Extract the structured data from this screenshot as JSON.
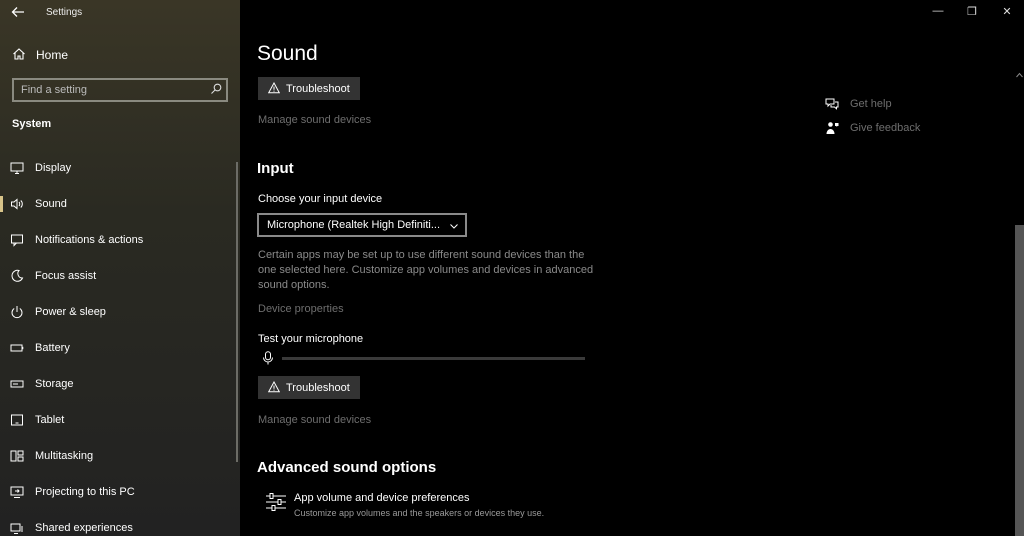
{
  "window": {
    "title": "Settings",
    "controls": {
      "minimize": "—",
      "restore": "❐",
      "close": "✕"
    }
  },
  "sidebar": {
    "home_label": "Home",
    "search_placeholder": "Find a setting",
    "section_label": "System",
    "items": [
      {
        "label": "Display",
        "icon": "display-icon"
      },
      {
        "label": "Sound",
        "icon": "speaker-icon",
        "active": true
      },
      {
        "label": "Notifications & actions",
        "icon": "notification-icon"
      },
      {
        "label": "Focus assist",
        "icon": "moon-icon"
      },
      {
        "label": "Power & sleep",
        "icon": "power-icon"
      },
      {
        "label": "Battery",
        "icon": "battery-icon"
      },
      {
        "label": "Storage",
        "icon": "storage-icon"
      },
      {
        "label": "Tablet",
        "icon": "tablet-icon"
      },
      {
        "label": "Multitasking",
        "icon": "multitasking-icon"
      },
      {
        "label": "Projecting to this PC",
        "icon": "projecting-icon"
      },
      {
        "label": "Shared experiences",
        "icon": "shared-icon"
      }
    ]
  },
  "main": {
    "page_title": "Sound",
    "output_troubleshoot": "Troubleshoot",
    "output_manage": "Manage sound devices",
    "input": {
      "heading": "Input",
      "choose_label": "Choose your input device",
      "selected_device": "Microphone (Realtek High Definiti...",
      "description": "Certain apps may be set up to use different sound devices than the one selected here. Customize app volumes and devices in advanced sound options.",
      "device_properties": "Device properties",
      "test_label": "Test your microphone",
      "mic_level": 0,
      "troubleshoot": "Troubleshoot",
      "manage": "Manage sound devices"
    },
    "advanced": {
      "heading": "Advanced sound options",
      "pref_title": "App volume and device preferences",
      "pref_subtitle": "Customize app volumes and the speakers or devices they use."
    },
    "help": {
      "get_help": "Get help",
      "give_feedback": "Give feedback"
    }
  }
}
